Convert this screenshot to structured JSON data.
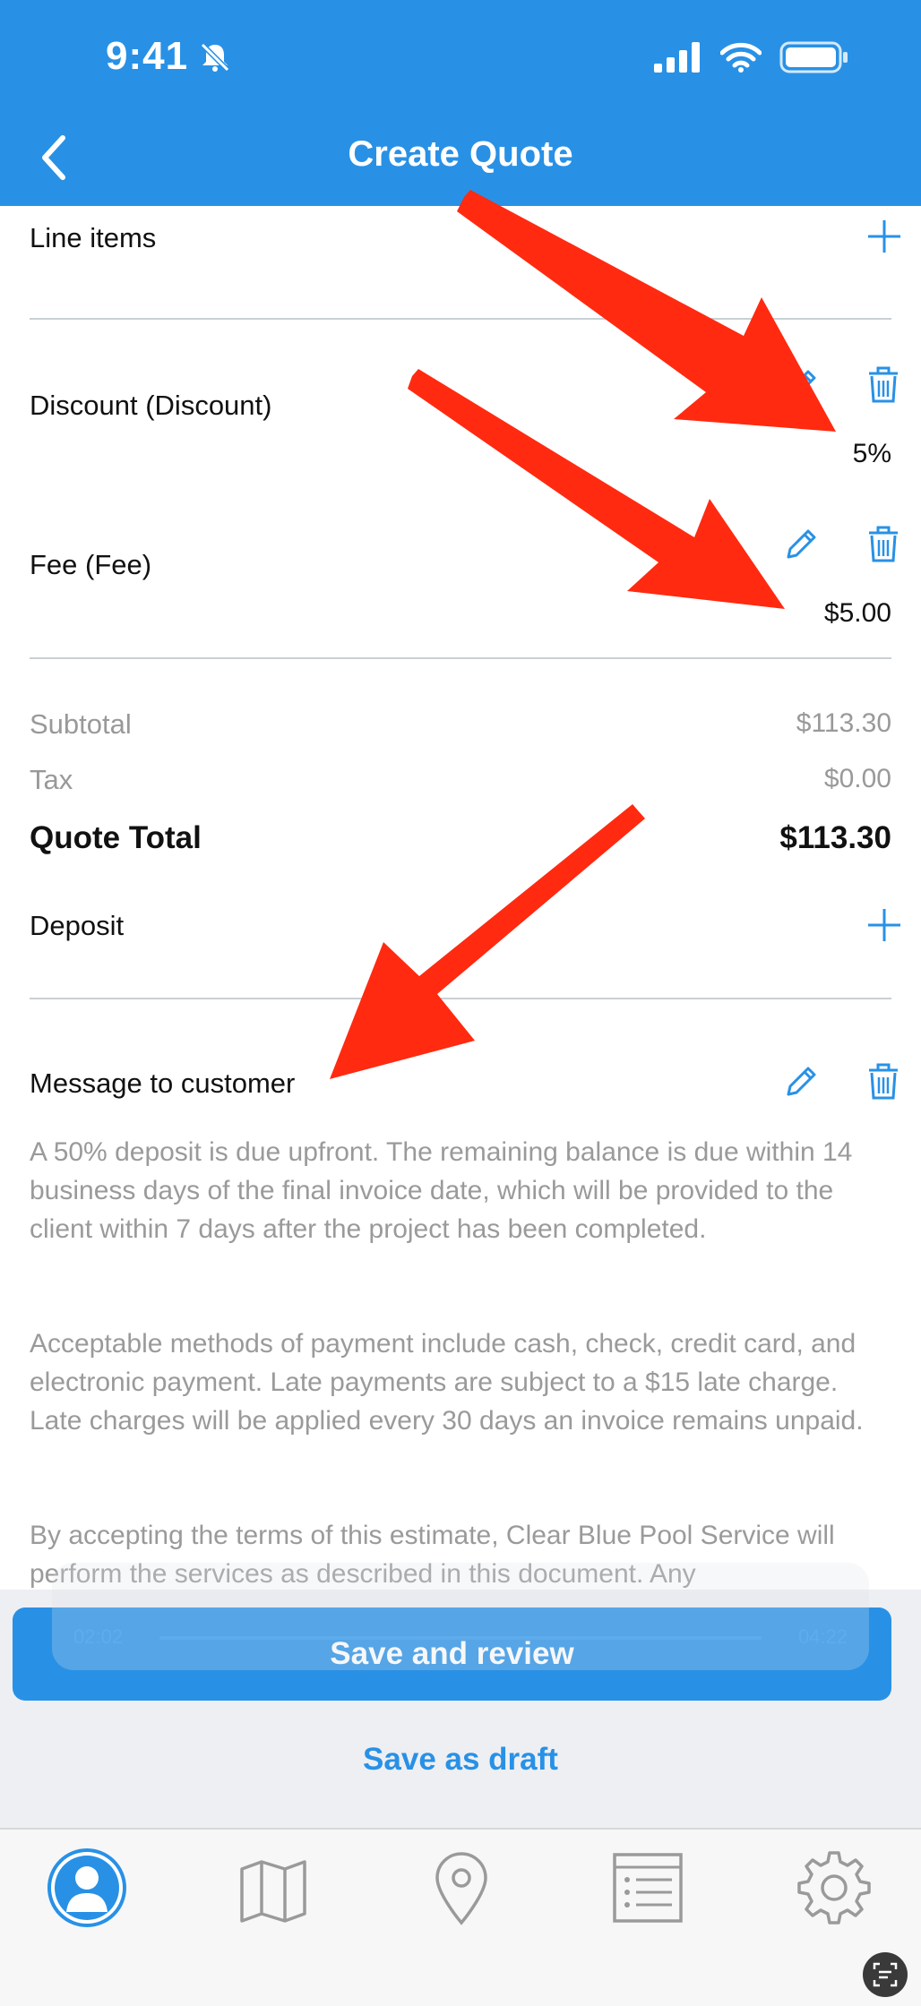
{
  "status_bar": {
    "time": "9:41"
  },
  "header": {
    "title": "Create Quote"
  },
  "line_items": {
    "label": "Line items"
  },
  "discount": {
    "label": "Discount (Discount)",
    "value": "5%"
  },
  "fee": {
    "label": "Fee (Fee)",
    "value": "$5.00"
  },
  "totals": {
    "subtotal_label": "Subtotal",
    "subtotal_value": "$113.30",
    "tax_label": "Tax",
    "tax_value": "$0.00",
    "total_label": "Quote Total",
    "total_value": "$113.30"
  },
  "deposit": {
    "label": "Deposit"
  },
  "message": {
    "label": "Message to customer",
    "paragraphs": [
      "A 50% deposit is due upfront. The remaining balance is due within 14 business days of the final invoice date, which will be provided to the client within 7 days after the project has been completed.",
      "Acceptable methods of payment include cash, check, credit card, and electronic payment. Late payments are subject to a $15 late charge. Late charges will be applied every 30 days an invoice remains unpaid.",
      "By accepting the terms of this estimate, Clear Blue Pool Service will perform the services as described in this document. Any"
    ]
  },
  "video": {
    "time_left": "02:02",
    "time_right": "04:22"
  },
  "actions": {
    "save_review": "Save and review",
    "save_draft": "Save as draft"
  },
  "tabbar": {
    "icons": [
      "profile-icon",
      "map-icon",
      "location-pin-icon",
      "list-icon",
      "gear-icon"
    ]
  },
  "colors": {
    "brand": "#2891e6",
    "annotation_arrow": "#ff2a10"
  }
}
